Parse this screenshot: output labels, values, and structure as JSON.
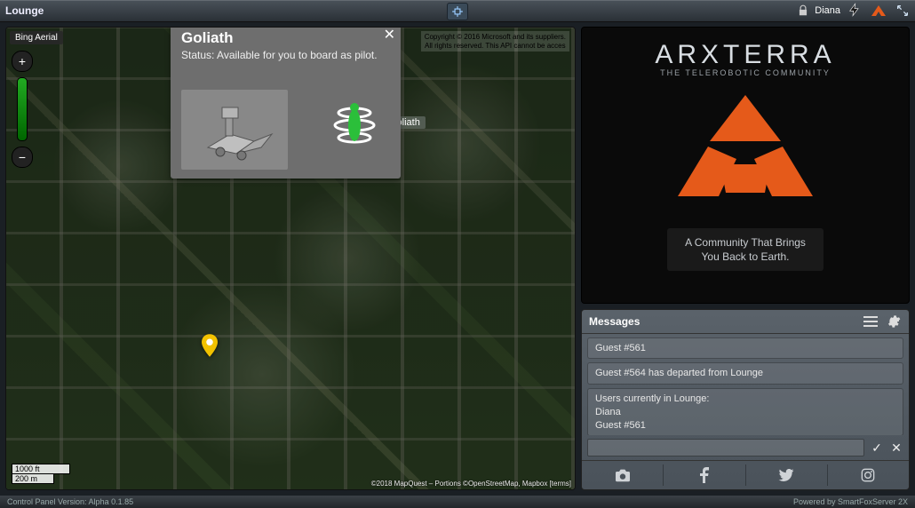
{
  "topbar": {
    "title": "Lounge",
    "user": "Diana"
  },
  "map": {
    "provider_label": "Bing Aerial",
    "bing_logo": "bing",
    "copyright_line1": "Copyright © 2016 Microsoft and its suppliers.",
    "copyright_line2": "All rights reserved. This API cannot be acces",
    "attribution": "©2018 MapQuest – Portions ©OpenStreetMap, Mapbox  [terms]",
    "scale_imperial": "1000 ft",
    "scale_metric": "200 m",
    "robot_marker_label": "Goliath"
  },
  "popup": {
    "title": "Goliath",
    "status_label": "Status:",
    "status_text": "Available for you to board as pilot."
  },
  "brand": {
    "title": "ARXTERRA",
    "subtitle": "THE TELEROBOTIC COMMUNITY",
    "tagline_line1": "A Community That Brings",
    "tagline_line2": "You Back to Earth."
  },
  "messages": {
    "header": "Messages",
    "items": [
      "Guest #561",
      "Guest #564 has departed from Lounge",
      "Users currently in Lounge:\nDiana\nGuest #561"
    ],
    "input_placeholder": ""
  },
  "footer": {
    "version": "Control Panel Version: Alpha 0.1.85",
    "powered": "Powered by SmartFoxServer 2X"
  }
}
